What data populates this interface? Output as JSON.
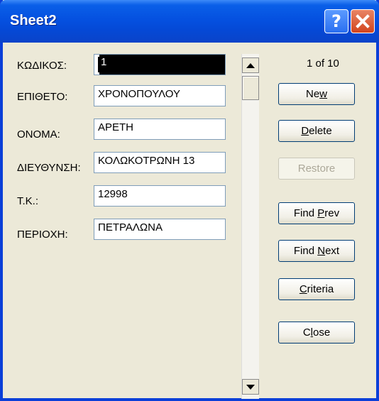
{
  "window": {
    "title": "Sheet2"
  },
  "fields": [
    {
      "label": "ΚΩΔΙΚΟΣ:",
      "value": "1"
    },
    {
      "label": "ΕΠΙΘΕΤΟ:",
      "value": "ΧΡΟΝΟΠΟΥΛΟΥ"
    },
    {
      "label": "ΟΝΟΜΑ:",
      "value": "ΑΡΕΤΗ"
    },
    {
      "label": "ΔΙΕΥΘΥΝΣΗ:",
      "value": "ΚΟΛΩΚΟΤΡΩΝΗ 13"
    },
    {
      "label": "Τ.Κ.:",
      "value": "12998"
    },
    {
      "label": "ΠΕΡΙΟΧΗ:",
      "value": "ΠΕΤΡΑΛΩΝΑ"
    }
  ],
  "record": {
    "counter": "1 of 10"
  },
  "buttons": {
    "new": {
      "pre": "Ne",
      "mnemonic": "w",
      "post": ""
    },
    "delete": {
      "pre": "",
      "mnemonic": "D",
      "post": "elete"
    },
    "restore": {
      "label": "Restore"
    },
    "find_prev": {
      "pre": "Find ",
      "mnemonic": "P",
      "post": "rev"
    },
    "find_next": {
      "pre": "Find ",
      "mnemonic": "N",
      "post": "ext"
    },
    "criteria": {
      "pre": "",
      "mnemonic": "C",
      "post": "riteria"
    },
    "close": {
      "pre": "C",
      "mnemonic": "l",
      "post": "ose"
    }
  },
  "colors": {
    "titlebar": "#0551e0",
    "dialog_bg": "#ece9d8",
    "close_button": "#d3441c"
  }
}
